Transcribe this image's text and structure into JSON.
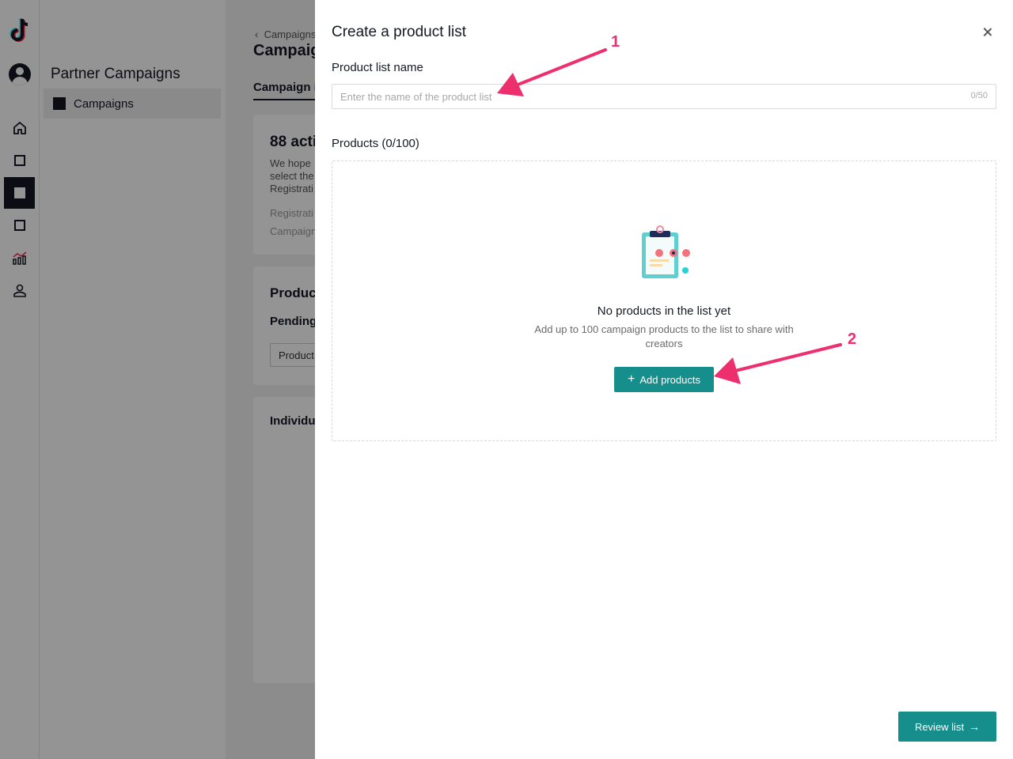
{
  "sidebar": {
    "title": "Partner Campaigns",
    "items": [
      {
        "label": "Campaigns"
      }
    ]
  },
  "main": {
    "breadcrumb": "Campaigns",
    "page_title": "Campaign",
    "tab": "Campaign in",
    "card1": {
      "heading": "88 acti",
      "line1": "We hope",
      "line2": "select the",
      "line3": "Registrati",
      "meta1": "Registrati",
      "meta2": "Campaign"
    },
    "card2": {
      "heading": "Produc",
      "sub": "Pending",
      "button": "Product"
    },
    "card3": {
      "heading": "Individu"
    }
  },
  "drawer": {
    "title": "Create a product list",
    "name_label": "Product list name",
    "name_value": "",
    "name_placeholder": "Enter the name of the product list",
    "name_counter": "0/50",
    "products_label": "Products (0/100)",
    "empty_title": "No products in the list yet",
    "empty_desc": "Add up to 100 campaign products to the list to share with creators",
    "add_button": "Add products",
    "review_button": "Review list"
  },
  "annotations": [
    "1",
    "2"
  ],
  "colors": {
    "accent": "#168e8b",
    "annotation": "#ee2f6d",
    "text": "#161823"
  },
  "icons": [
    "tiktok-logo-icon",
    "avatar-icon",
    "home-icon",
    "chart-icon",
    "person-icon",
    "close-icon",
    "plus-icon",
    "arrow-right-icon",
    "clipboard-illustration-icon"
  ]
}
